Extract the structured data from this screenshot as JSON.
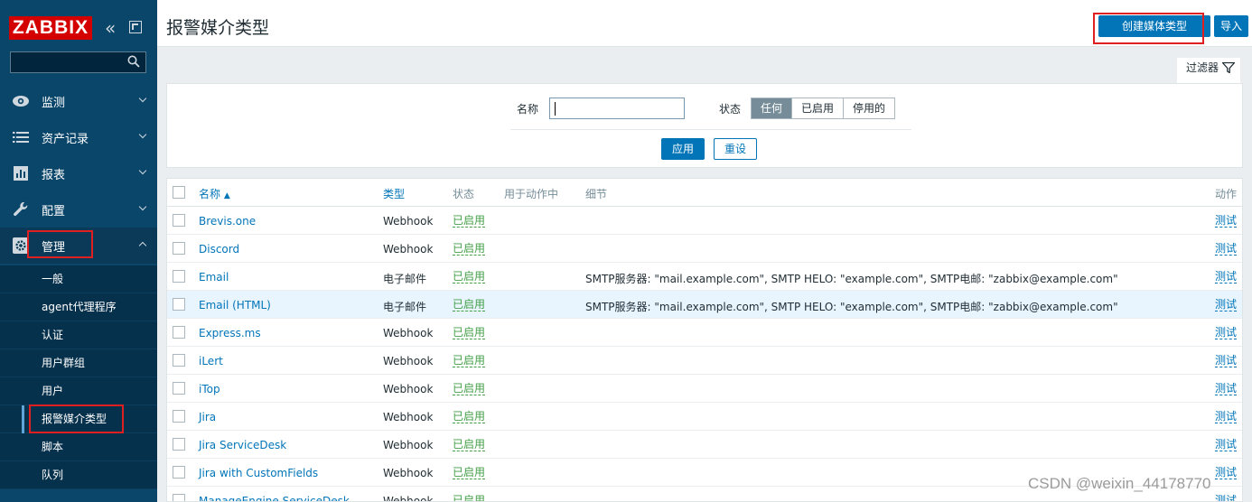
{
  "sidebar": {
    "logo_text": "ZABBIX",
    "menu": [
      {
        "label": "监测"
      },
      {
        "label": "资产记录"
      },
      {
        "label": "报表"
      },
      {
        "label": "配置"
      },
      {
        "label": "管理"
      }
    ],
    "submenu": [
      {
        "label": "一般"
      },
      {
        "label": "agent代理程序"
      },
      {
        "label": "认证"
      },
      {
        "label": "用户群组"
      },
      {
        "label": "用户"
      },
      {
        "label": "报警媒介类型"
      },
      {
        "label": "脚本"
      },
      {
        "label": "队列"
      }
    ]
  },
  "header": {
    "title": "报警媒介类型",
    "create_button": "创建媒体类型",
    "import_button": "导入"
  },
  "filter": {
    "tab_label": "过滤器",
    "name_label": "名称",
    "name_value": "",
    "status_label": "状态",
    "status_options": [
      "任何",
      "已启用",
      "停用的"
    ],
    "status_selected": "任何",
    "apply_button": "应用",
    "reset_button": "重设"
  },
  "table": {
    "columns": {
      "name": "名称",
      "type": "类型",
      "status": "状态",
      "used_in_actions": "用于动作中",
      "details": "细节",
      "action": "动作"
    },
    "rows": [
      {
        "name": "Brevis.one",
        "type": "Webhook",
        "status": "已启用",
        "details": "",
        "action": "测试"
      },
      {
        "name": "Discord",
        "type": "Webhook",
        "status": "已启用",
        "details": "",
        "action": "测试"
      },
      {
        "name": "Email",
        "type": "电子邮件",
        "status": "已启用",
        "details": "SMTP服务器: \"mail.example.com\", SMTP HELO: \"example.com\", SMTP电邮: \"zabbix@example.com\"",
        "action": "测试"
      },
      {
        "name": "Email (HTML)",
        "type": "电子邮件",
        "status": "已启用",
        "details": "SMTP服务器: \"mail.example.com\", SMTP HELO: \"example.com\", SMTP电邮: \"zabbix@example.com\"",
        "action": "测试"
      },
      {
        "name": "Express.ms",
        "type": "Webhook",
        "status": "已启用",
        "details": "",
        "action": "测试"
      },
      {
        "name": "iLert",
        "type": "Webhook",
        "status": "已启用",
        "details": "",
        "action": "测试"
      },
      {
        "name": "iTop",
        "type": "Webhook",
        "status": "已启用",
        "details": "",
        "action": "测试"
      },
      {
        "name": "Jira",
        "type": "Webhook",
        "status": "已启用",
        "details": "",
        "action": "测试"
      },
      {
        "name": "Jira ServiceDesk",
        "type": "Webhook",
        "status": "已启用",
        "details": "",
        "action": "测试"
      },
      {
        "name": "Jira with CustomFields",
        "type": "Webhook",
        "status": "已启用",
        "details": "",
        "action": "测试"
      },
      {
        "name": "ManageEngine ServiceDesk",
        "type": "Webhook",
        "status": "已启用",
        "details": "",
        "action": "测试"
      }
    ]
  },
  "watermark": "CSDN @weixin_44178770"
}
